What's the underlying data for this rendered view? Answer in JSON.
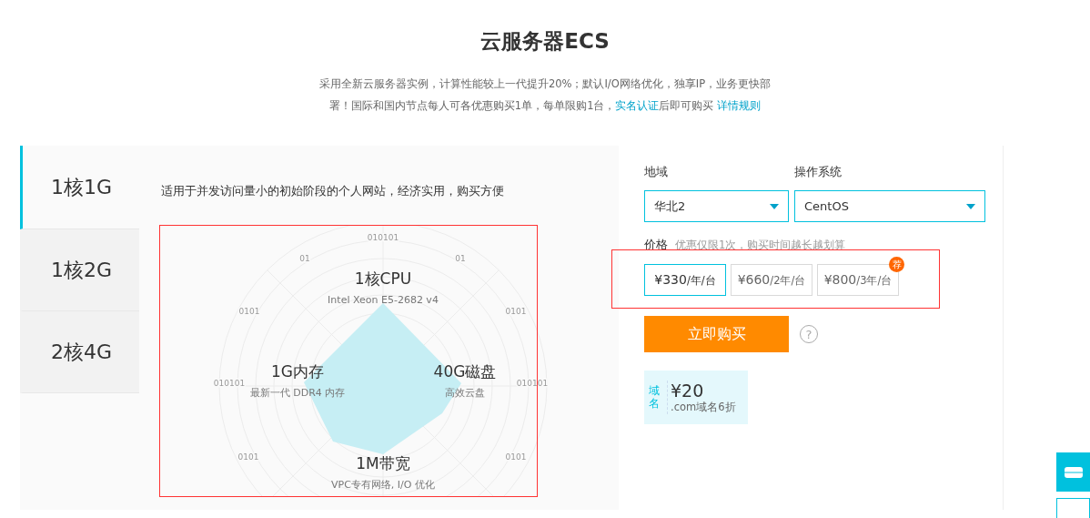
{
  "title": "云服务器ECS",
  "intro": {
    "text_before": "采用全新云服务器实例，计算性能较上一代提升20%；默认I/O网络优化，独享IP，业务更快部署！国际和国内节点每人可各优惠购买1单，每单限购1台，",
    "link": "实名认证",
    "text_after": "后即可购买",
    "rules_link": "详情规则"
  },
  "plans": [
    {
      "label": "1核1G",
      "selected": true
    },
    {
      "label": "1核2G",
      "selected": false
    },
    {
      "label": "2核4G",
      "selected": false
    }
  ],
  "plan_description": "适用于并发访问量小的初始阶段的个人网站，经济实用，购买方便",
  "radar": {
    "ring_labels": [
      "010101",
      "01",
      "01",
      "0101",
      "0101",
      "010101",
      "010101",
      "0101",
      "0101"
    ],
    "specs": [
      {
        "title": "1核CPU",
        "detail": "Intel Xeon E5-2682 v4"
      },
      {
        "title": "1G内存",
        "detail": "最新一代 DDR4 内存"
      },
      {
        "title": "40G磁盘",
        "detail": "高效云盘"
      },
      {
        "title": "1M带宽",
        "detail": "VPC专有网络, I/O 优化"
      }
    ]
  },
  "region": {
    "label": "地域",
    "value": "华北2"
  },
  "os": {
    "label": "操作系统",
    "value": "CentOS"
  },
  "price": {
    "label": "价格",
    "hint": "优惠仅限1次，购买时间越长越划算",
    "options": [
      {
        "amount": "¥330",
        "unit": "/年/台",
        "selected": true
      },
      {
        "amount": "¥660",
        "unit": "/2年/台",
        "selected": false
      },
      {
        "amount": "¥800",
        "unit": "/3年/台",
        "selected": false,
        "badge": "荐"
      }
    ]
  },
  "buy_button": "立即购买",
  "help_icon": "?",
  "coupon": {
    "tag": "域名",
    "amount": "¥20",
    "text": ".com域名6折"
  }
}
